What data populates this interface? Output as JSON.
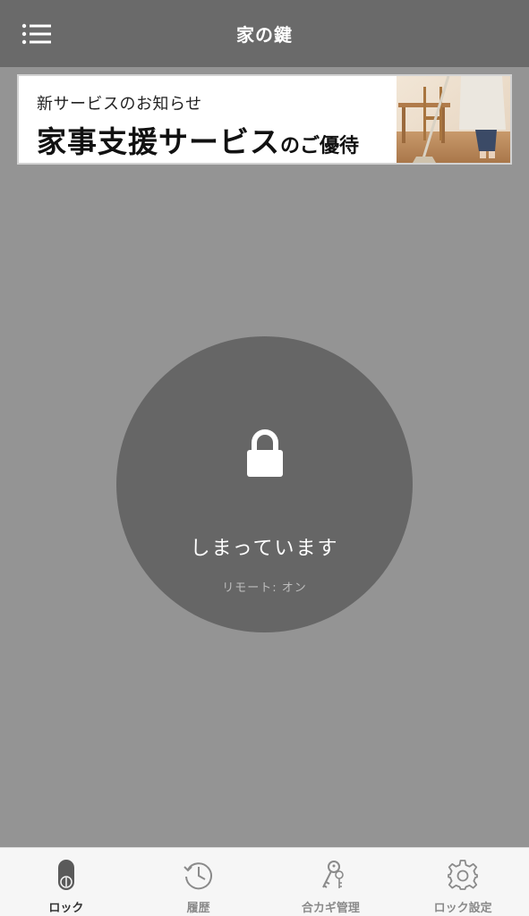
{
  "header": {
    "title": "家の鍵",
    "menu_icon": "hamburger-menu-icon"
  },
  "banner": {
    "subtitle": "新サービスのお知らせ",
    "headline": "家事支援サービス",
    "headline_suffix": "のご優待"
  },
  "lock": {
    "icon": "padlock-icon",
    "status": "しまっています",
    "remote": "リモート: オン"
  },
  "tabs": [
    {
      "label": "ロック",
      "icon": "lock-toggle-icon",
      "active": true
    },
    {
      "label": "履歴",
      "icon": "history-clock-icon",
      "active": false
    },
    {
      "label": "合カギ管理",
      "icon": "keys-icon",
      "active": false
    },
    {
      "label": "ロック設定",
      "icon": "gear-icon",
      "active": false
    }
  ],
  "colors": {
    "header_bg": "#6a6a6a",
    "page_bg": "#949494",
    "circle_bg": "#666666",
    "tabbar_bg": "#f6f6f6"
  }
}
